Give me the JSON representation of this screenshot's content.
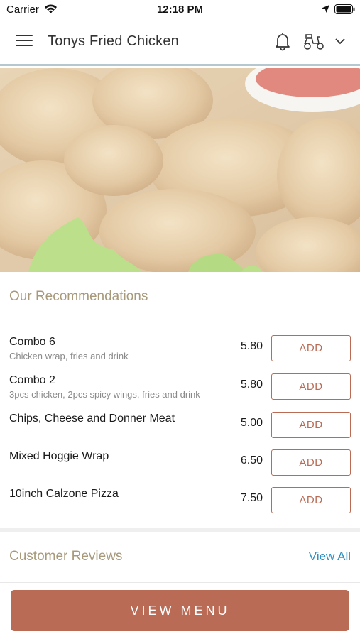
{
  "status_bar": {
    "carrier": "Carrier",
    "time": "12:18 PM",
    "icons": [
      "wifi-icon",
      "location-arrow-icon",
      "battery-icon"
    ]
  },
  "header": {
    "title": "Tonys Fried Chicken",
    "icons": [
      "hamburger-menu-icon",
      "bell-icon",
      "delivery-scooter-icon",
      "chevron-down-icon"
    ]
  },
  "hero": {
    "image": "fried-chicken-photo"
  },
  "recommendations": {
    "title": "Our Recommendations",
    "add_label": "ADD",
    "items": [
      {
        "name": "Combo 6",
        "description": "Chicken wrap, fries and drink",
        "price": "5.80"
      },
      {
        "name": "Combo 2",
        "description": "3pcs chicken, 2pcs spicy wings, fries and drink",
        "price": "5.80"
      },
      {
        "name": "Chips, Cheese and Donner Meat",
        "description": "",
        "price": "5.00"
      },
      {
        "name": "Mixed Hoggie Wrap",
        "description": "",
        "price": "6.50"
      },
      {
        "name": "10inch Calzone Pizza",
        "description": "",
        "price": "7.50"
      }
    ]
  },
  "reviews": {
    "title": "Customer Reviews",
    "view_all": "View All"
  },
  "footer": {
    "view_menu": "VIEW MENU"
  },
  "colors": {
    "accent": "#b96b55",
    "section_title": "#a8997a",
    "link": "#2e8fc2"
  }
}
